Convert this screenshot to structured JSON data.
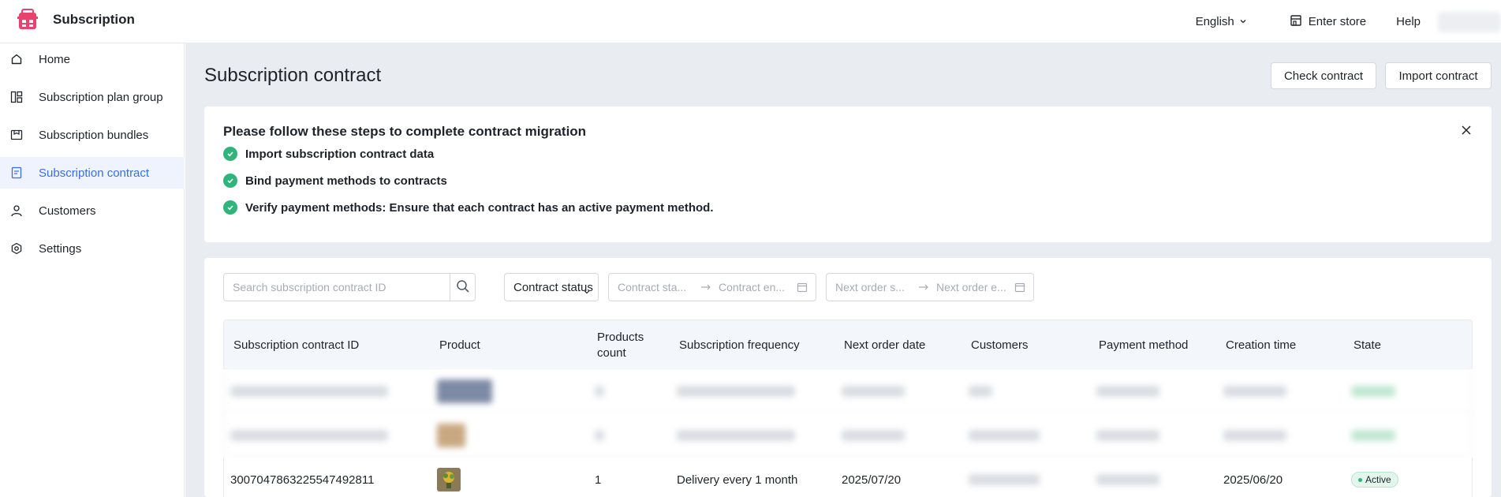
{
  "header": {
    "app_title": "Subscription",
    "language": "English",
    "enter_store": "Enter store",
    "help": "Help"
  },
  "sidebar": {
    "items": [
      {
        "label": "Home",
        "icon": "home-icon"
      },
      {
        "label": "Subscription plan group",
        "icon": "plan-group-icon"
      },
      {
        "label": "Subscription bundles",
        "icon": "bundle-icon"
      },
      {
        "label": "Subscription contract",
        "icon": "contract-icon",
        "active": true
      },
      {
        "label": "Customers",
        "icon": "user-icon"
      },
      {
        "label": "Settings",
        "icon": "settings-icon"
      }
    ]
  },
  "page": {
    "title": "Subscription contract",
    "check_contract": "Check contract",
    "import_contract": "Import contract"
  },
  "steps": {
    "title": "Please follow these steps to complete contract migration",
    "items": [
      "Import subscription contract data",
      "Bind payment methods to contracts",
      "Verify payment methods: Ensure that each contract has an active payment method."
    ]
  },
  "filters": {
    "search_placeholder": "Search subscription contract ID",
    "status_label": "Contract status",
    "contract_start_placeholder": "Contract sta...",
    "contract_end_placeholder": "Contract en...",
    "next_order_start_placeholder": "Next order s...",
    "next_order_end_placeholder": "Next order e..."
  },
  "table": {
    "columns": [
      "Subscription contract ID",
      "Product",
      "Products count",
      "Subscription frequency",
      "Next order date",
      "Customers",
      "Payment method",
      "Creation time",
      "State"
    ],
    "visible_row": {
      "id": "3007047863225547492811",
      "count": "1",
      "frequency": "Delivery every 1 month",
      "next_order_date": "2025/07/20",
      "creation_time": "2025/06/20",
      "state": "Active"
    }
  },
  "colors": {
    "accent": "#3a6fe3",
    "brand": "#e8436e",
    "success": "#2fb47c",
    "main_bg": "#e9ecf1"
  }
}
